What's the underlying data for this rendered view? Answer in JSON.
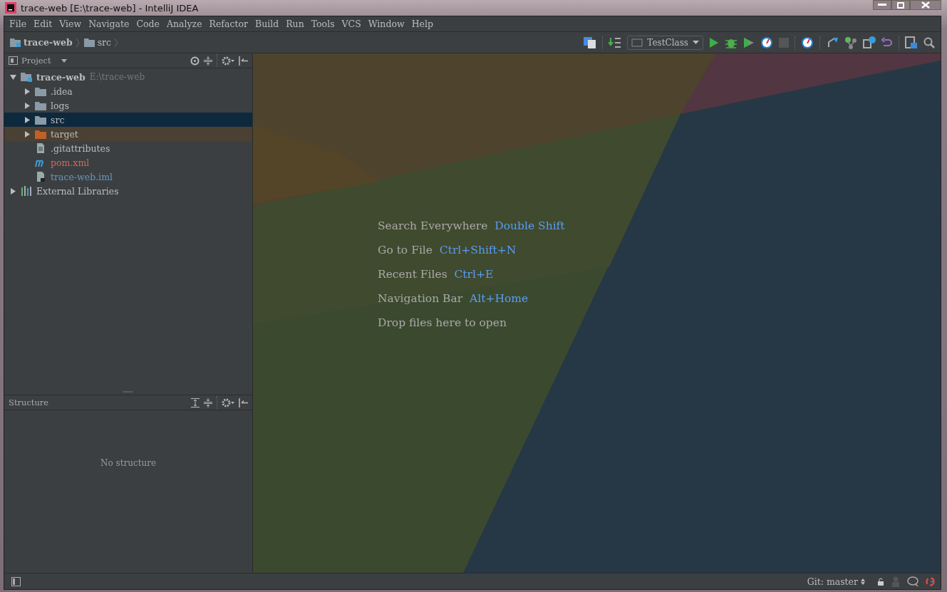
{
  "window": {
    "title": "trace-web [E:\\trace-web] - IntelliJ IDEA"
  },
  "menu": [
    "File",
    "Edit",
    "View",
    "Navigate",
    "Code",
    "Analyze",
    "Refactor",
    "Build",
    "Run",
    "Tools",
    "VCS",
    "Window",
    "Help"
  ],
  "breadcrumbs": [
    {
      "label": "trace-web",
      "kind": "project"
    },
    {
      "label": "src",
      "kind": "folder"
    }
  ],
  "toolbar": {
    "run_config": "TestClass"
  },
  "project_panel": {
    "title": "Project",
    "tree": [
      {
        "label": "trace-web",
        "path": "E:\\trace-web",
        "kind": "project",
        "expanded": true,
        "selected": false,
        "children": [
          {
            "label": ".idea",
            "kind": "folder",
            "expanded": false,
            "selected": false,
            "color": "#bbbbbb"
          },
          {
            "label": "logs",
            "kind": "folder",
            "expanded": false,
            "selected": false,
            "color": "#bbbbbb"
          },
          {
            "label": "src",
            "kind": "folder",
            "expanded": false,
            "selected": true,
            "color": "#bbbbbb"
          },
          {
            "label": "target",
            "kind": "excluded-folder",
            "expanded": false,
            "selected": false,
            "color": "#bbbbbb"
          },
          {
            "label": ".gitattributes",
            "kind": "text-file",
            "selected": false,
            "color": "#bbbbbb"
          },
          {
            "label": "pom.xml",
            "kind": "maven-file",
            "selected": false,
            "color": "#d1675a"
          },
          {
            "label": "trace-web.iml",
            "kind": "module-file",
            "selected": false,
            "color": "#6897bb"
          }
        ]
      },
      {
        "label": "External Libraries",
        "kind": "libraries",
        "expanded": false,
        "selected": false
      }
    ]
  },
  "structure_panel": {
    "title": "Structure",
    "empty_text": "No structure"
  },
  "editor_hints": [
    {
      "label": "Search Everywhere",
      "shortcut": "Double Shift"
    },
    {
      "label": "Go to File",
      "shortcut": "Ctrl+Shift+N"
    },
    {
      "label": "Recent Files",
      "shortcut": "Ctrl+E"
    },
    {
      "label": "Navigation Bar",
      "shortcut": "Alt+Home"
    },
    {
      "label": "Drop files here to open"
    }
  ],
  "status_bar": {
    "git_branch": "Git: master"
  }
}
